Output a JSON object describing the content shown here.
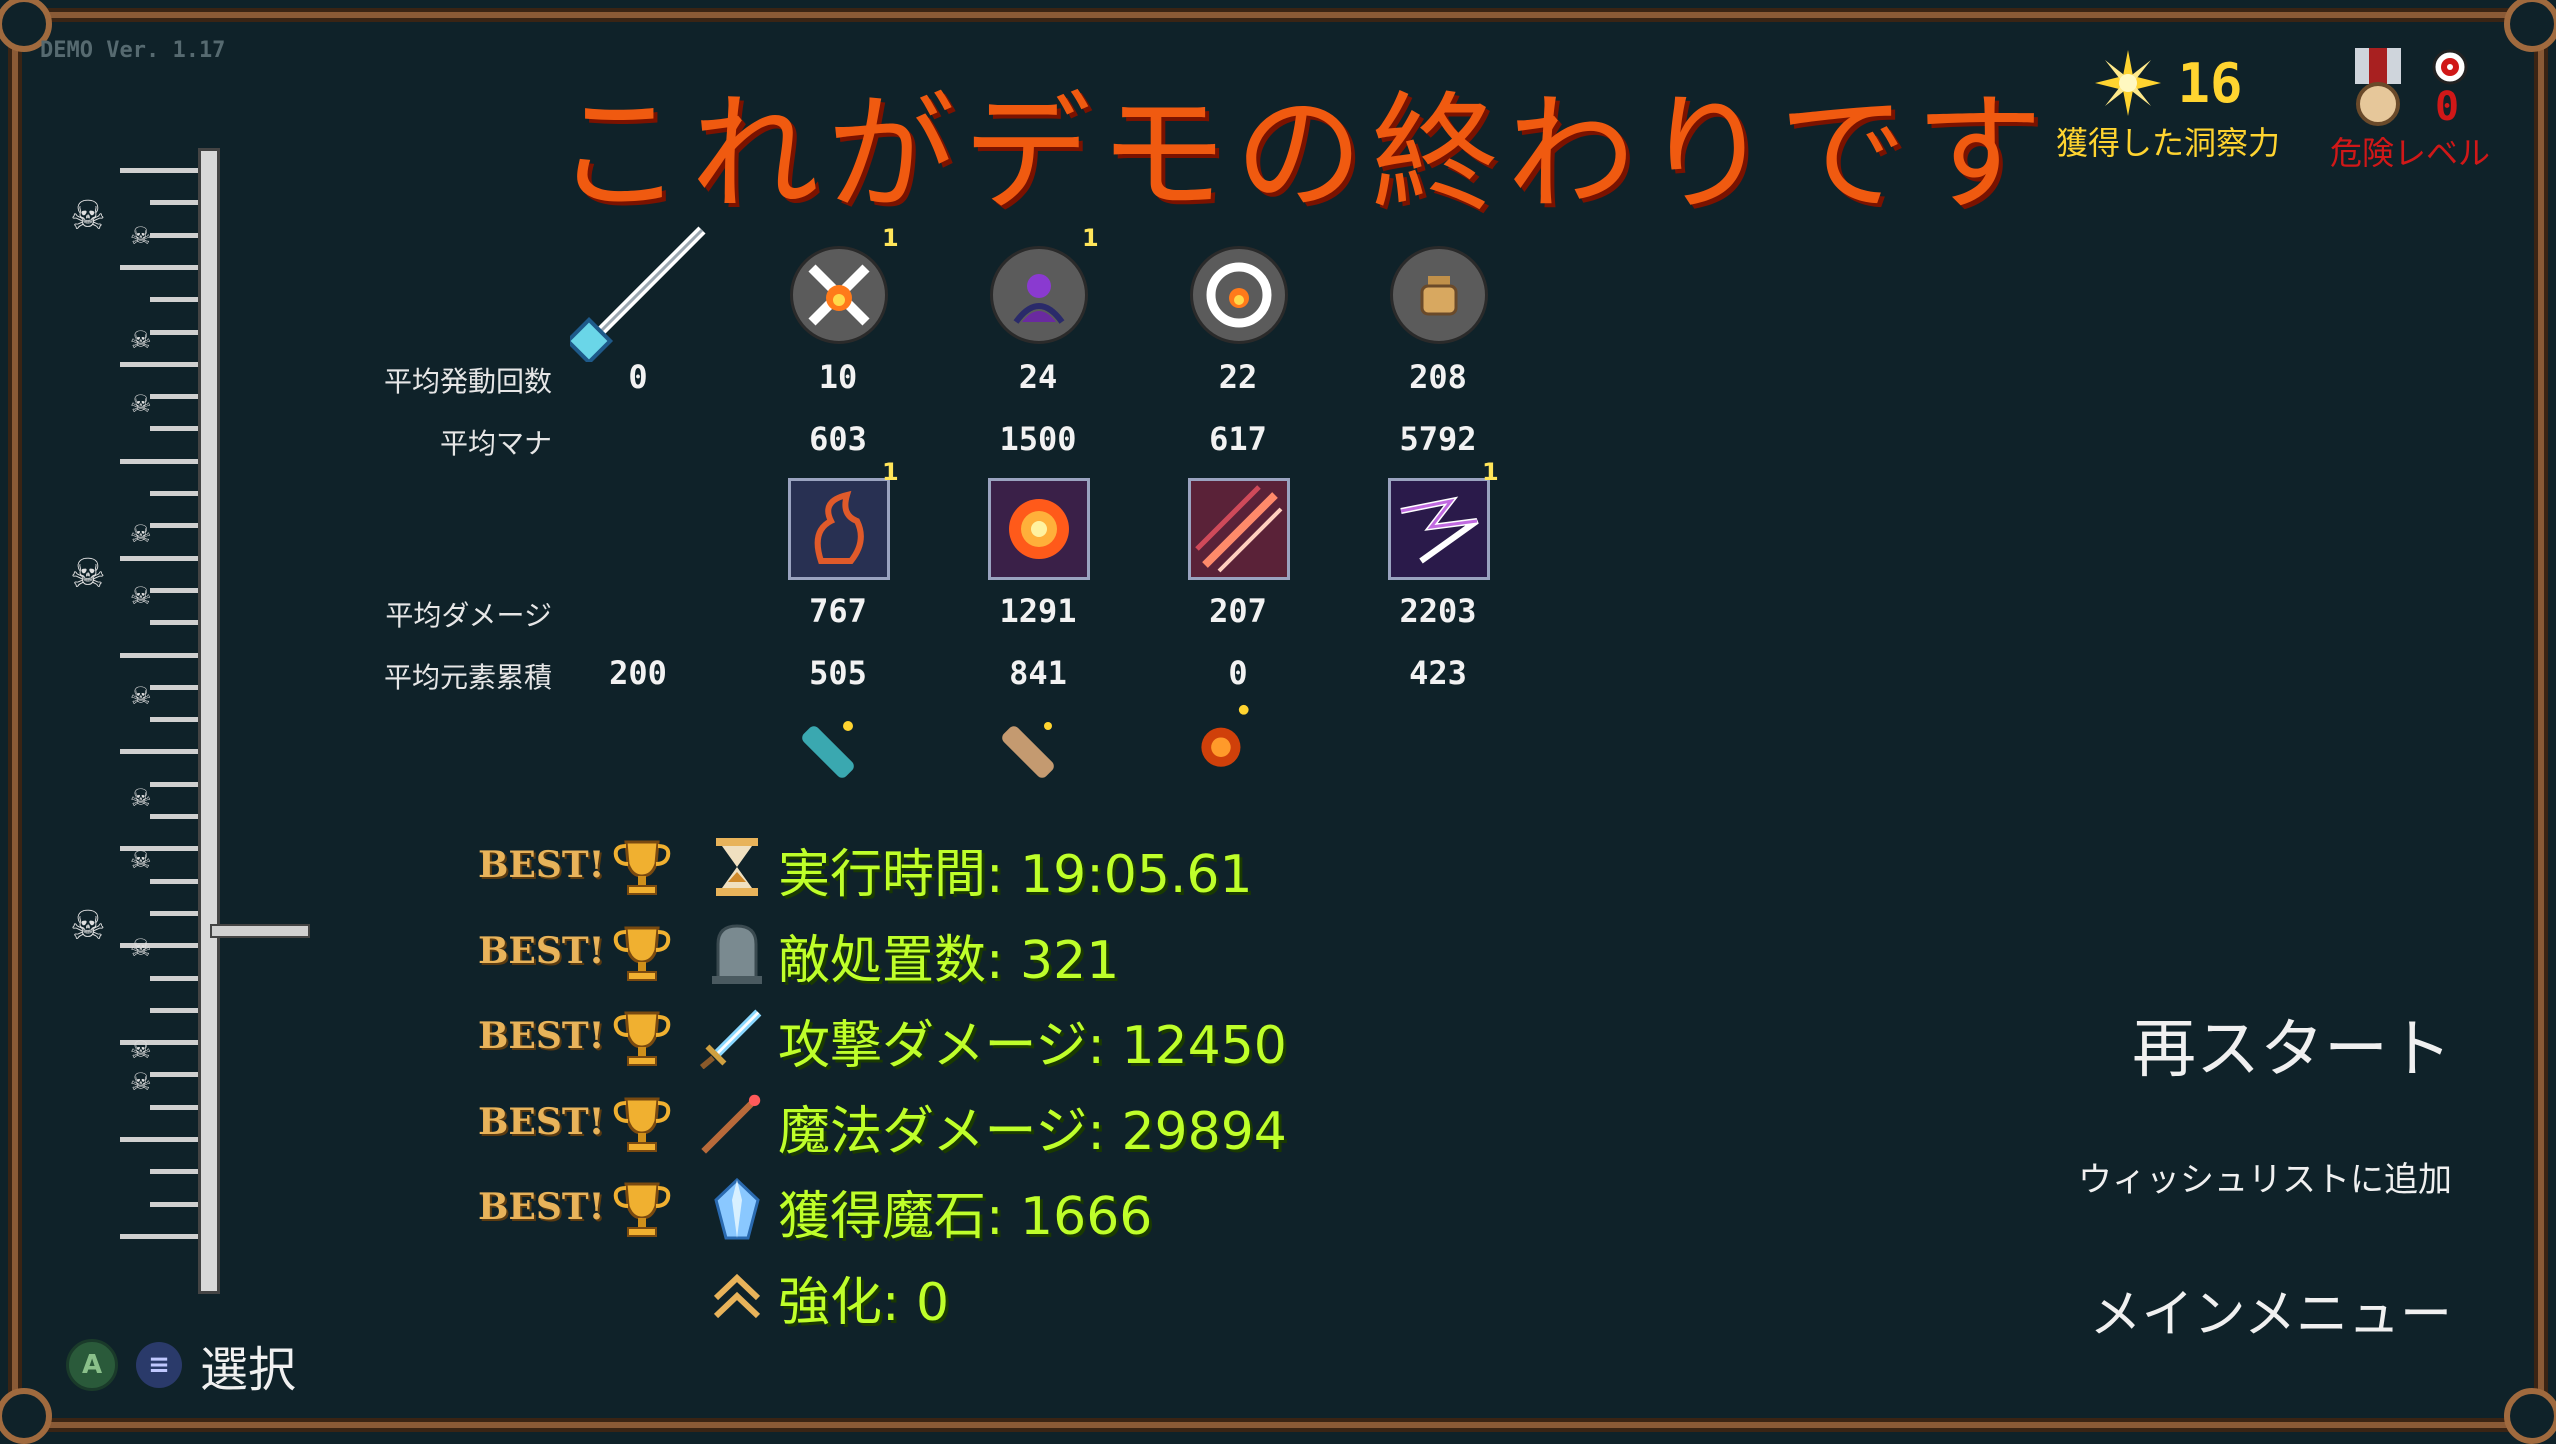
{
  "version": "DEMO Ver. 1.17",
  "title": "これがデモの終わりです",
  "hud": {
    "insight_value": "16",
    "insight_label": "獲得した洞察力",
    "danger_value": "0",
    "danger_label": "危険レベル"
  },
  "table": {
    "row_labels": {
      "activations": "平均発動回数",
      "mana": "平均マナ",
      "damage": "平均ダメージ",
      "elemental": "平均元素累積"
    },
    "columns": [
      {
        "activations": "0",
        "mana": "",
        "damage": "",
        "elemental": "200",
        "badge": "",
        "icon": "magic-staff-icon"
      },
      {
        "activations": "10",
        "mana": "603",
        "damage": "767",
        "elemental": "505",
        "badge": "1",
        "icon": "fire-cross-spell-icon"
      },
      {
        "activations": "24",
        "mana": "1500",
        "damage": "1291",
        "elemental": "841",
        "badge": "1",
        "icon": "shadow-summon-spell-icon"
      },
      {
        "activations": "22",
        "mana": "617",
        "damage": "207",
        "elemental": "0",
        "badge": "",
        "icon": "fire-ring-spell-icon"
      },
      {
        "activations": "208",
        "mana": "5792",
        "damage": "2203",
        "elemental": "423",
        "badge": "",
        "icon": "bag-spell-icon"
      }
    ],
    "effect_badges": [
      "1",
      "",
      "",
      "1"
    ]
  },
  "stats": [
    {
      "best": "BEST!",
      "text": "実行時間: 19:05.61",
      "icon": "hourglass-icon"
    },
    {
      "best": "BEST!",
      "text": "敵処置数: 321",
      "icon": "tombstone-icon"
    },
    {
      "best": "BEST!",
      "text": "攻撃ダメージ: 12450",
      "icon": "sword-icon"
    },
    {
      "best": "BEST!",
      "text": "魔法ダメージ: 29894",
      "icon": "wand-icon"
    },
    {
      "best": "BEST!",
      "text": "獲得魔石: 1666",
      "icon": "crystal-icon"
    },
    {
      "best": "",
      "text": "強化: 0",
      "icon": "chevron-up-icon"
    }
  ],
  "menu": {
    "restart": "再スタート",
    "wishlist": "ウィッシュリストに追加",
    "main_menu": "メインメニュー"
  },
  "controls": {
    "a_button": "A",
    "select_label": "選択"
  },
  "colors": {
    "background": "#0f2229",
    "title": "#f05a10",
    "stat_text": "#bfff2a",
    "insight": "#ffd430",
    "danger": "#d01818"
  }
}
